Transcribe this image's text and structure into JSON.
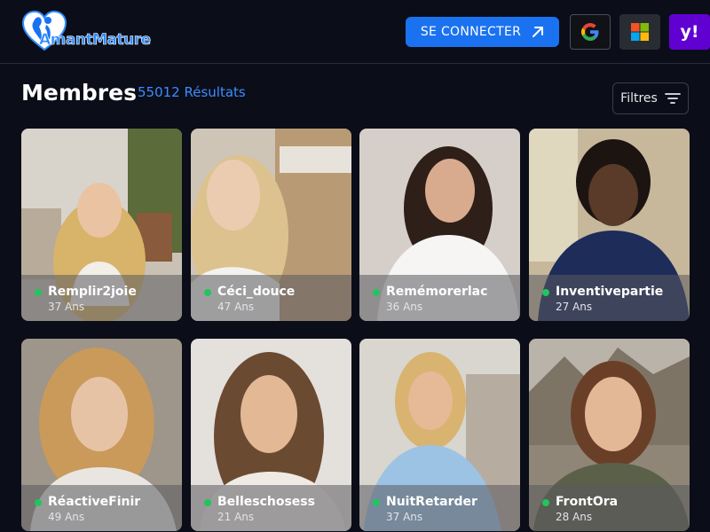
{
  "brand": {
    "name": "AmantMature",
    "accent": "#1a72f0"
  },
  "header": {
    "login_label": "SE CONNECTER",
    "yahoo_label": "y!"
  },
  "main": {
    "title": "Membres",
    "results": "55012 Résultats",
    "filters_label": "Filtres"
  },
  "members": [
    {
      "name": "Remplir2joie",
      "age": "37 Ans",
      "online": true
    },
    {
      "name": "Céci_douce",
      "age": "47 Ans",
      "online": true
    },
    {
      "name": "Remémorerlac",
      "age": "36 Ans",
      "online": true
    },
    {
      "name": "Inventivepartie",
      "age": "27 Ans",
      "online": true
    },
    {
      "name": "RéactiveFinir",
      "age": "49 Ans",
      "online": true
    },
    {
      "name": "Belleschosess",
      "age": "21 Ans",
      "online": true
    },
    {
      "name": "NuitRetarder",
      "age": "37 Ans",
      "online": true
    },
    {
      "name": "FrontOra",
      "age": "28 Ans",
      "online": true
    }
  ]
}
